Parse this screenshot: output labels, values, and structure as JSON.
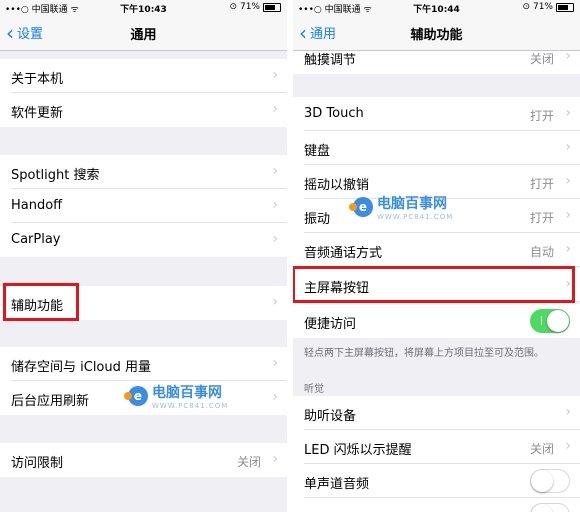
{
  "left": {
    "status": {
      "carrier": "•••○ 中国联通 ᯤ",
      "time": "下午10:43",
      "battery": "71%"
    },
    "nav": {
      "back_label": "设置",
      "title": "通用"
    },
    "rows": {
      "about": "关于本机",
      "software_update": "软件更新",
      "spotlight": "Spotlight 搜索",
      "handoff": "Handoff",
      "carplay": "CarPlay",
      "accessibility": "辅助功能",
      "storage": "储存空间与 iCloud 用量",
      "background_refresh": "后台应用刷新",
      "restrictions": "访问限制",
      "restrictions_value": "关闭"
    }
  },
  "right": {
    "status": {
      "carrier": "•••○ 中国联通 ᯤ",
      "time": "下午10:44",
      "battery": "71%"
    },
    "nav": {
      "back_label": "通用",
      "title": "辅助功能"
    },
    "rows": {
      "touch_accommodations": "触摸调节",
      "touch_accommodations_value": "关闭",
      "touch_3d": "3D Touch",
      "touch_3d_value": "打开",
      "keyboard": "键盘",
      "shake_to_undo": "摇动以撤销",
      "shake_to_undo_value": "打开",
      "vibration": "振动",
      "vibration_value": "打开",
      "call_audio_routing": "音频通话方式",
      "call_audio_routing_value": "自动",
      "home_button": "主屏幕按钮",
      "reachability": "便捷访问",
      "reachability_footer": "轻点两下主屏幕按钮，将屏幕上方项目拉至可及范围。",
      "hearing_header": "听觉",
      "hearing_devices": "助听设备",
      "led_flash": "LED 闪烁以示提醒",
      "led_flash_value": "关闭",
      "mono_audio": "单声道音频"
    },
    "toggles": {
      "reachability_on": true,
      "mono_audio_on": false
    }
  },
  "watermark": {
    "text": "电脑百事网",
    "url": "WWW.PC841.COM"
  },
  "colors": {
    "accent": "#157efb",
    "switch_on": "#4cd964",
    "highlight": "#e1151b"
  }
}
